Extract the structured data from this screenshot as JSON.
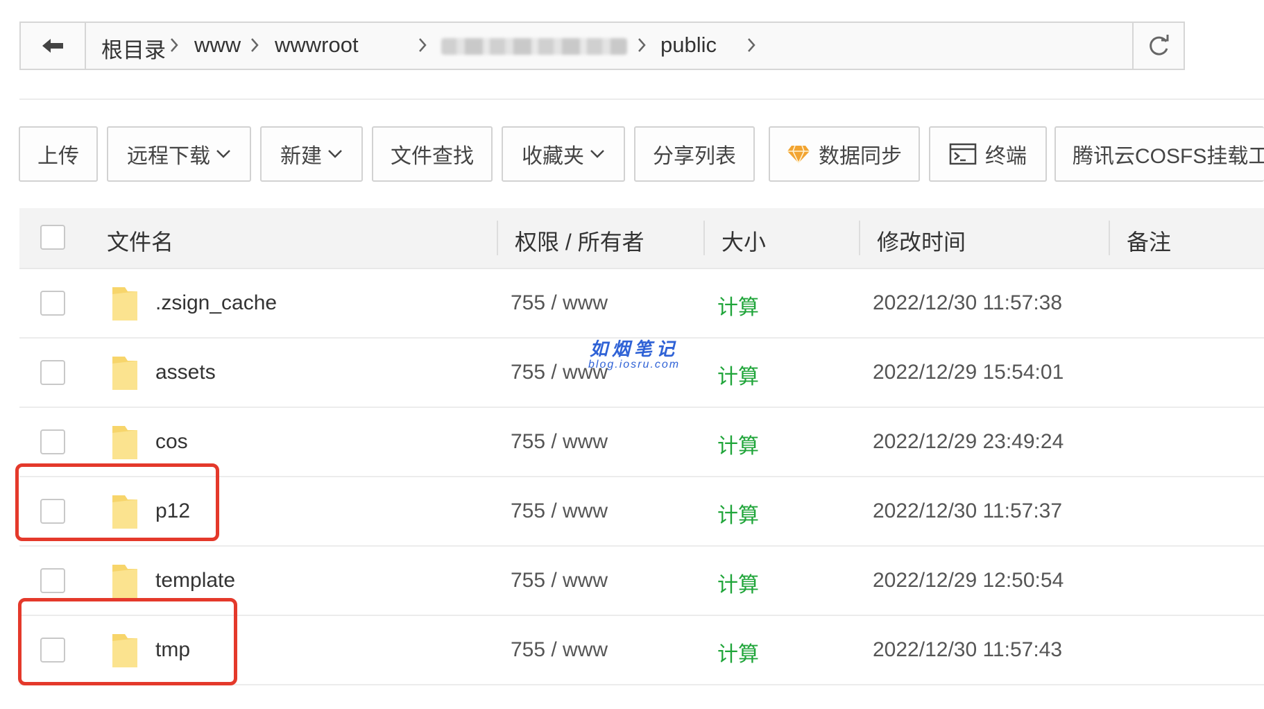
{
  "breadcrumb": {
    "items": [
      "根目录",
      "www",
      "wwwroot",
      "public"
    ]
  },
  "toolbar": {
    "upload": "上传",
    "remote_download": "远程下载",
    "new": "新建",
    "file_search": "文件查找",
    "favorites": "收藏夹",
    "share_list": "分享列表",
    "data_sync": "数据同步",
    "terminal": "终端",
    "cosfs_mount": "腾讯云COSFS挂载工"
  },
  "table": {
    "headers": {
      "name": "文件名",
      "permission": "权限 / 所有者",
      "size": "大小",
      "modified": "修改时间",
      "remark": "备注"
    },
    "rows": [
      {
        "name": ".zsign_cache",
        "permission": "755 / www",
        "size": "计算",
        "modified": "2022/12/30 11:57:38"
      },
      {
        "name": "assets",
        "permission": "755 / www",
        "size": "计算",
        "modified": "2022/12/29 15:54:01"
      },
      {
        "name": "cos",
        "permission": "755 / www",
        "size": "计算",
        "modified": "2022/12/29 23:49:24"
      },
      {
        "name": "p12",
        "permission": "755 / www",
        "size": "计算",
        "modified": "2022/12/30 11:57:37"
      },
      {
        "name": "template",
        "permission": "755 / www",
        "size": "计算",
        "modified": "2022/12/29 12:50:54"
      },
      {
        "name": "tmp",
        "permission": "755 / www",
        "size": "计算",
        "modified": "2022/12/30 11:57:43"
      }
    ]
  },
  "watermark": {
    "title": "如烟笔记",
    "url": "blog.iosru.com"
  },
  "colors": {
    "accent_green": "#20a53a",
    "highlight_red": "#e4392b",
    "folder_yellow": "#f7d56b",
    "watermark_blue": "#2f62d6"
  },
  "icons": [
    "back-arrow-icon",
    "chevron-right-icon",
    "refresh-icon",
    "chevron-down-icon",
    "diamond-icon",
    "terminal-icon",
    "folder-icon"
  ]
}
